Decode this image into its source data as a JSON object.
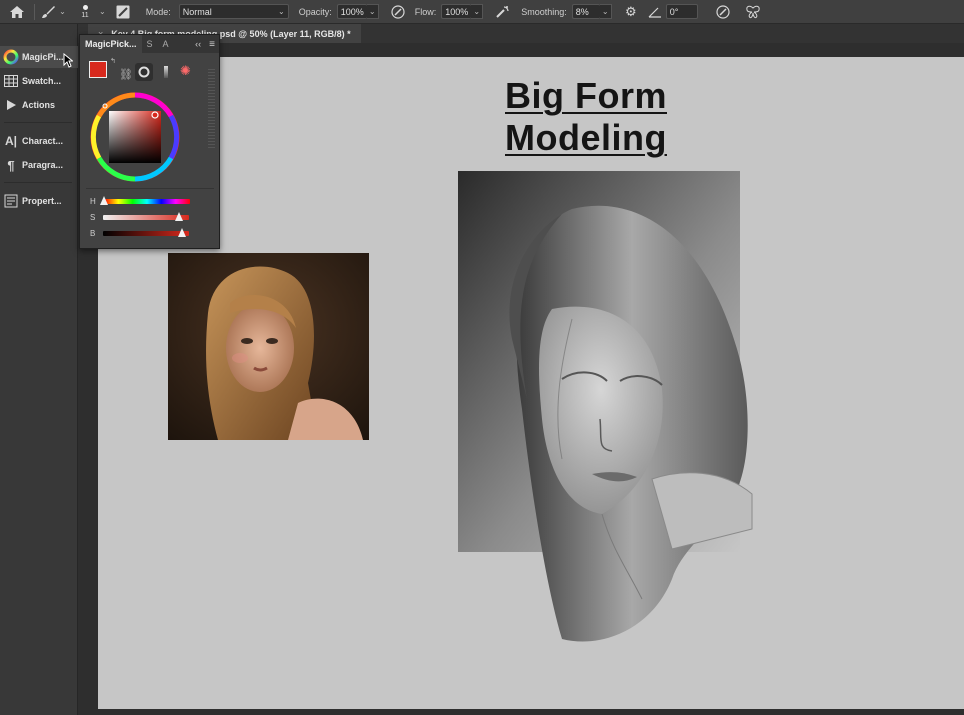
{
  "options_bar": {
    "brush_size": "11",
    "mode_label": "Mode:",
    "mode_value": "Normal",
    "opacity_label": "Opacity:",
    "opacity_value": "100%",
    "flow_label": "Flow:",
    "flow_value": "100%",
    "smoothing_label": "Smoothing:",
    "smoothing_value": "8%",
    "angle_value": "0°"
  },
  "document_tab": {
    "title": "Key 4 Big form modeling.psd @ 50% (Layer 11, RGB/8) *"
  },
  "dock": {
    "items": [
      {
        "label": "MagicPi...",
        "icon": "color-wheel-icon"
      },
      {
        "label": "Swatch...",
        "icon": "grid-icon"
      },
      {
        "label": "Actions",
        "icon": "play-icon"
      },
      {
        "label": "Charact...",
        "icon": "type-icon"
      },
      {
        "label": "Paragra...",
        "icon": "pilcrow-icon"
      },
      {
        "label": "Propert...",
        "icon": "properties-icon"
      }
    ]
  },
  "magic_panel": {
    "tabs": [
      "MagicPick...",
      "S",
      "A"
    ],
    "current_color": "#d8291d",
    "slider_h_label": "H",
    "slider_s_label": "S",
    "slider_b_label": "B",
    "h_value": 0.0,
    "s_value": 0.88,
    "b_value": 0.92
  },
  "canvas": {
    "title": "Big Form Modeling",
    "background": "#c6c6c6"
  }
}
